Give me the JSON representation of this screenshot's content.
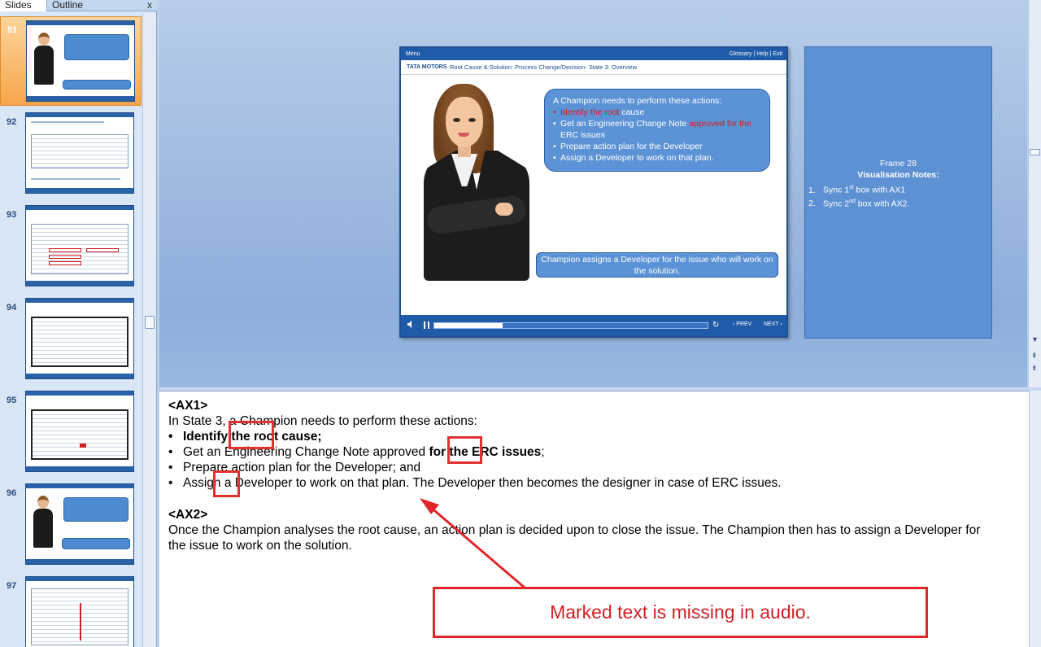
{
  "left_pane": {
    "tabs": [
      "Slides",
      "Outline"
    ],
    "close_glyph": "x",
    "slides": [
      {
        "number": "91",
        "selected": true,
        "kind": "avatar"
      },
      {
        "number": "92",
        "selected": false,
        "kind": "table"
      },
      {
        "number": "93",
        "selected": false,
        "kind": "form"
      },
      {
        "number": "94",
        "selected": false,
        "kind": "form2"
      },
      {
        "number": "95",
        "selected": false,
        "kind": "form3"
      },
      {
        "number": "96",
        "selected": false,
        "kind": "avatar"
      },
      {
        "number": "97",
        "selected": false,
        "kind": "list"
      }
    ]
  },
  "player": {
    "menu": "Menu",
    "top_links": "Glossary | Help | Exit",
    "brand": "TATA MOTORS",
    "title": "Root Cause & Solution: Process Change/Decision- State 3: Overview",
    "bubble": {
      "intro": "A Champion needs to perform these actions:",
      "item1_red": "Identify the root",
      "item1_rest": " cause",
      "item2_start": "Get an Engineering Change Note ",
      "item2_red": "approved for the",
      "item2_end": "ERC issues",
      "item3": "Prepare action plan for the Developer",
      "item4": "Assign a Developer to work on that plan."
    },
    "bubble_small": "Champion assigns a Developer for the issue who will work on the solution.",
    "controls": {
      "prev": "‹ PREV",
      "next": "NEXT ›",
      "progress": 0.25
    }
  },
  "notes_panel": {
    "frame": "Frame 28",
    "title": "Visualisation Notes:",
    "items": [
      {
        "n": "1.",
        "pre": "Sync 1",
        "sup": "st",
        "post": " box with AX1"
      },
      {
        "n": "2.",
        "pre": "Sync 2",
        "sup": "nd",
        "post": " box with AX2."
      }
    ]
  },
  "notes": {
    "ax1_tag": "<AX1>",
    "ax1_intro": "In State 3, a Champion needs to perform these actions:",
    "bullet": "•",
    "b1": "Identify the root cause;",
    "b2_start": "Get an Engineering Change Note approved ",
    "b2_bold": "for the ERC issues",
    "b2_end": ";",
    "b3": "Prepare action plan for the Developer; and",
    "b4": "Assign a Developer to work on that plan. The Developer then becomes the designer in case of ERC issues.",
    "ax2_tag": "<AX2>",
    "ax2_line1": "Once the Champion analyses the root cause, an action plan is decided upon to close the issue. The Champion then has to assign a Developer for",
    "ax2_line2": "the issue to work on the solution."
  },
  "annotation": {
    "callout": "Marked text is missing in audio.",
    "color": "#e0262a"
  }
}
